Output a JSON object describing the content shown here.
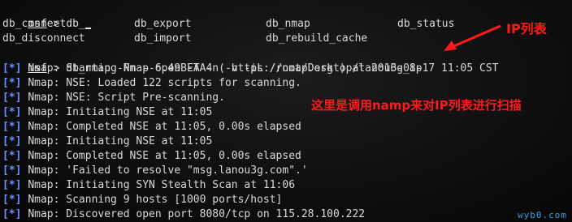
{
  "prompt": "msf",
  "prompt_sep": " > ",
  "command_partial": "db_",
  "completions": {
    "row1": [
      "db_connect",
      "db_export",
      "db_nmap",
      "db_status"
    ],
    "row2": [
      "db_disconnect",
      "db_import",
      "db_rebuild_cache"
    ]
  },
  "command_full": "db_nmap -Pn --open -A -n -v -iL /root/Desktop/lanou3g_ip",
  "output_marker": "[*]",
  "output": [
    "Nmap: Starting Nmap 6.49BETA4 ( https://nmap.org ) at 2016-08-17 11:05 CST",
    "Nmap: NSE: Loaded 122 scripts for scanning.",
    "Nmap: NSE: Script Pre-scanning.",
    "Nmap: Initiating NSE at 11:05",
    "Nmap: Completed NSE at 11:05, 0.00s elapsed",
    "Nmap: Initiating NSE at 11:05",
    "Nmap: Completed NSE at 11:05, 0.00s elapsed",
    "Nmap: 'Failed to resolve \"msg.lanou3g.com\".'",
    "Nmap: Initiating SYN Stealth Scan at 11:06",
    "Nmap: Scanning 9 hosts [1000 ports/host]",
    "Nmap: Discovered open port 8080/tcp on 115.28.100.222"
  ],
  "annotations": {
    "ip_list": "IP列表",
    "nmap_note": "这里是调用namp来对IP列表进行扫描"
  },
  "watermark": "wyb0.com",
  "colors": {
    "background": "#000000",
    "text": "#d9d9d9",
    "marker": "#6f8fff",
    "annotation": "#ff1a1a",
    "watermark": "#3aa0d8"
  }
}
